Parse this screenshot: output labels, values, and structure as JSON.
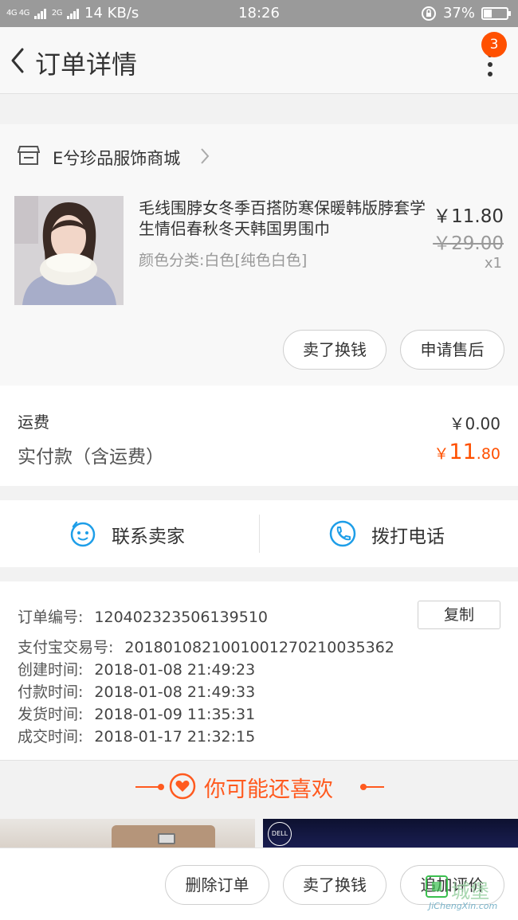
{
  "status_bar": {
    "signal_left": "4G 4G",
    "signal_right": "2G",
    "net_speed": "14 KB/s",
    "time": "18:26",
    "battery": "37%",
    "battery_level": 0.37
  },
  "navbar": {
    "title": "订单详情",
    "badge": "3"
  },
  "shop": {
    "name": "E兮珍品服饰商城"
  },
  "item": {
    "title": "毛线围脖女冬季百搭防寒保暖韩版脖套学生情侣春秋冬天韩国男围巾",
    "variant": "颜色分类:白色[纯色白色]",
    "price": "￥11.80",
    "original_price": "￥29.00",
    "quantity": "x1",
    "actions": [
      "卖了换钱",
      "申请售后"
    ]
  },
  "fees": {
    "shipping_label": "运费",
    "shipping_value": "￥0.00",
    "paid_label": "实付款（含运费）",
    "paid_currency": "￥",
    "paid_int": "11",
    "paid_dec": ".80"
  },
  "contact": {
    "seller": "联系卖家",
    "phone": "拨打电话"
  },
  "order_info": {
    "copy": "复制",
    "rows": [
      {
        "k": "订单编号:",
        "v": "120402323506139510"
      },
      {
        "k": "支付宝交易号:",
        "v": "2018010821001001270210035362"
      },
      {
        "k": "创建时间:",
        "v": "2018-01-08 21:49:23"
      },
      {
        "k": "付款时间:",
        "v": "2018-01-08 21:49:33"
      },
      {
        "k": "发货时间:",
        "v": "2018-01-09 11:35:31"
      },
      {
        "k": "成交时间:",
        "v": "2018-01-17 21:32:15"
      }
    ]
  },
  "recommend": {
    "title": "你可能还喜欢",
    "dell_logo": "DELL"
  },
  "bottom_bar": {
    "buttons": [
      "删除订单",
      "卖了换钱",
      "追加评价"
    ]
  },
  "watermark": {
    "text": "城堡",
    "sub": "JiChengXin.com"
  },
  "colors": {
    "accent": "#ff5000",
    "recommend": "#ff5a1f",
    "status_bar": "#9a9a9a",
    "contact_icon": "#1e9ee8"
  }
}
